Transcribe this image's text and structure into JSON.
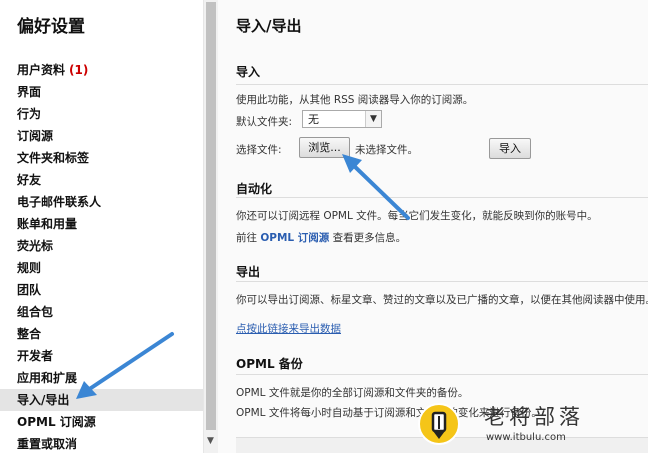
{
  "sidebar": {
    "title": "偏好设置",
    "items": [
      {
        "label": "用户资料",
        "count": "(1)"
      },
      {
        "label": "界面"
      },
      {
        "label": "行为"
      },
      {
        "label": "订阅源"
      },
      {
        "label": "文件夹和标签"
      },
      {
        "label": "好友"
      },
      {
        "label": "电子邮件联系人"
      },
      {
        "label": "账单和用量"
      },
      {
        "label": "荧光标"
      },
      {
        "label": "规则"
      },
      {
        "label": "团队"
      },
      {
        "label": "组合包"
      },
      {
        "label": "整合"
      },
      {
        "label": "开发者"
      },
      {
        "label": "应用和扩展"
      },
      {
        "label": "导入/导出",
        "active": true
      },
      {
        "label": "OPML 订阅源"
      },
      {
        "label": "重置或取消"
      }
    ]
  },
  "main": {
    "title": "导入/导出",
    "import": {
      "title": "导入",
      "desc": "使用此功能，从其他 RSS 阅读器导入你的订阅源。",
      "folder_label": "默认文件夹:",
      "folder_value": "无",
      "file_label": "选择文件:",
      "browse_label": "浏览...",
      "no_file": "未选择文件。",
      "import_button": "导入"
    },
    "automation": {
      "title": "自动化",
      "line1": "你还可以订阅远程 OPML 文件。每当它们发生变化，就能反映到你的账号中。",
      "line2_prefix": "前往",
      "line2_link": "OPML 订阅源",
      "line2_suffix": "查看更多信息。"
    },
    "export": {
      "title": "导出",
      "desc": "你可以导出订阅源、标星文章、赞过的文章以及已广播的文章，以便在其他阅读器中使用。",
      "link": "点按此链接来导出数据"
    },
    "backup": {
      "title": "OPML 备份",
      "line1": "OPML 文件就是你的全部订阅源和文件夹的备份。",
      "line2": "OPML 文件将每小时自动基于订阅源和文件夹的变化来进行备份。"
    }
  },
  "watermark": {
    "name": "老将部落",
    "url": "www.itbulu.com"
  },
  "colors": {
    "link": "#2a5db0",
    "arrow": "#3b86d4",
    "active_bg": "#e4e4e4",
    "count": "#cc0000"
  }
}
